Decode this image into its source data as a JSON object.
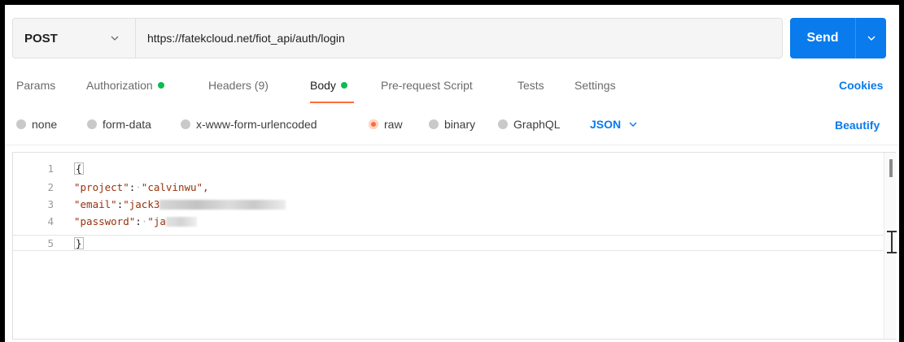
{
  "request": {
    "method": "POST",
    "url": "https://fatekcloud.net/fiot_api/auth/login",
    "send_label": "Send"
  },
  "tabs": [
    {
      "label": "Params",
      "dot": false,
      "active": false
    },
    {
      "label": "Authorization",
      "dot": true,
      "active": false
    },
    {
      "label": "Headers (9)",
      "dot": false,
      "active": false
    },
    {
      "label": "Body",
      "dot": true,
      "active": true
    },
    {
      "label": "Pre-request Script",
      "dot": false,
      "active": false
    },
    {
      "label": "Tests",
      "dot": false,
      "active": false
    },
    {
      "label": "Settings",
      "dot": false,
      "active": false
    }
  ],
  "cookies_label": "Cookies",
  "body_types": [
    {
      "label": "none",
      "selected": false
    },
    {
      "label": "form-data",
      "selected": false
    },
    {
      "label": "x-www-form-urlencoded",
      "selected": false
    },
    {
      "label": "raw",
      "selected": true
    },
    {
      "label": "binary",
      "selected": false
    },
    {
      "label": "GraphQL",
      "selected": false
    }
  ],
  "format_select": "JSON",
  "beautify_label": "Beautify",
  "editor": {
    "line_numbers": [
      "1",
      "2",
      "3",
      "4",
      "5"
    ],
    "open_brace": "{",
    "close_brace": "}",
    "project_key": "\"project\"",
    "project_value": "\"calvinwu\",",
    "email_key": "\"email\"",
    "email_value_visible": "\"jack3",
    "password_key": "\"password\"",
    "password_value_visible": "\"ja"
  },
  "colors": {
    "accent": "#097bed",
    "active_tab_underline": "#ff6c37",
    "dot_green": "#0cbb52",
    "string": "#95320c"
  }
}
